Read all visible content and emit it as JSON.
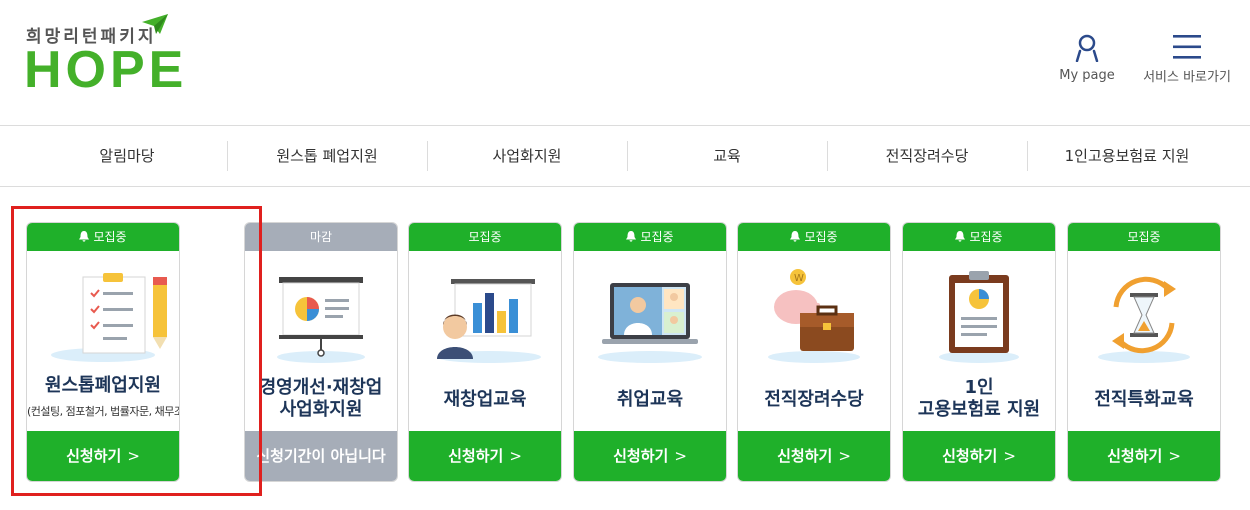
{
  "header": {
    "logo_sub": "희망리턴패키지",
    "logo_main": "HOPE",
    "mypage_label": "My page",
    "services_label": "서비스 바로가기"
  },
  "nav": {
    "items": [
      "알림마당",
      "원스톱 폐업지원",
      "사업화지원",
      "교육",
      "전직장려수당",
      "1인고용보험료 지원"
    ]
  },
  "cards": [
    {
      "status": "모집중",
      "title": "원스톱폐업지원",
      "subtitle": "(컨설팅, 점포철거, 법률자문, 채무조정)",
      "button": "신청하기",
      "bell": true
    },
    {
      "status": "마감",
      "title_line1": "경영개선·재창업",
      "title_line2": "사업화지원",
      "button": "신청기간이 아닙니다",
      "bell": false
    },
    {
      "status": "모집중",
      "title": "재창업교육",
      "button": "신청하기",
      "bell": false
    },
    {
      "status": "모집중",
      "title": "취업교육",
      "button": "신청하기",
      "bell": true
    },
    {
      "status": "모집중",
      "title": "전직장려수당",
      "button": "신청하기",
      "bell": true
    },
    {
      "status": "모집중",
      "title_line1": "1인",
      "title_line2": "고용보험료 지원",
      "button": "신청하기",
      "bell": true
    },
    {
      "status": "모집중",
      "title": "전직특화교육",
      "button": "신청하기",
      "bell": false
    }
  ],
  "colors": {
    "brand_green": "#1fb02a",
    "closed_gray": "#a6adb8",
    "title_navy": "#1d3558",
    "highlight_red": "#e0201e"
  }
}
